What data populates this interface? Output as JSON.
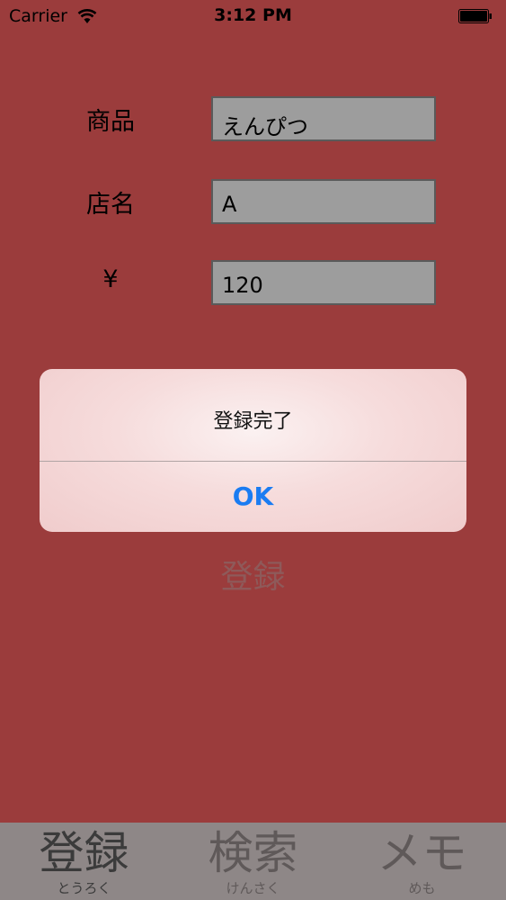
{
  "status_bar": {
    "carrier": "Carrier",
    "time": "3:12 PM"
  },
  "form": {
    "product_label": "商品",
    "product_value": "えんぴつ",
    "store_label": "店名",
    "store_value": "A",
    "price_label": "¥",
    "price_value": "120"
  },
  "register_button_label": "登録",
  "alert": {
    "message": "登録完了",
    "ok_label": "OK"
  },
  "tabs": [
    {
      "label": "登録",
      "sub": "とうろく"
    },
    {
      "label": "検索",
      "sub": "けんさく"
    },
    {
      "label": "メモ",
      "sub": "めも"
    }
  ],
  "colors": {
    "background": "#9b3c3c",
    "alert_button": "#1a7cf2",
    "tabbar": "#8e8787"
  }
}
